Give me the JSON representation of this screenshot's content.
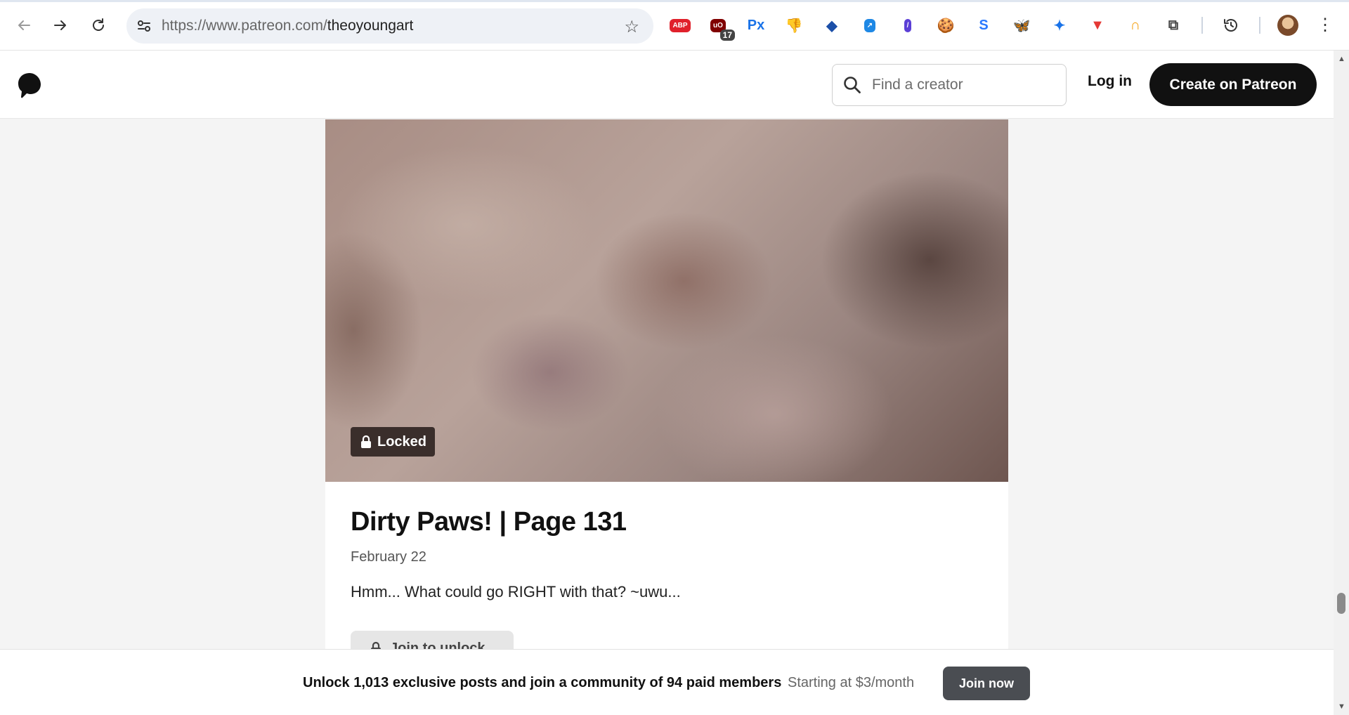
{
  "browser": {
    "url_prefix": "https://www.patreon.com/",
    "url_path": "theoyoungart",
    "extensions": [
      {
        "name": "abp-icon",
        "label": "ABP",
        "color": "#e0202b",
        "text_color": "#ffffff"
      },
      {
        "name": "ublock-icon",
        "label": "uO",
        "color": "#800000",
        "text_color": "#ffffff",
        "badge": "17"
      },
      {
        "name": "pixiv-px-icon",
        "label": "Px",
        "color": "#ffffff",
        "text_color": "#1a73e8"
      },
      {
        "name": "thumbs-down-icon",
        "label": "👎",
        "color": "#ffffff",
        "text_color": "#e00000"
      },
      {
        "name": "bitwarden-icon",
        "label": "◆",
        "color": "#ffffff",
        "text_color": "#1b4fa8"
      },
      {
        "name": "arrow-extension-icon",
        "label": "↗",
        "color": "#1e88e5",
        "text_color": "#ffffff"
      },
      {
        "name": "pen-extension-icon",
        "label": "/",
        "color": "#5b3fd6",
        "text_color": "#ffffff"
      },
      {
        "name": "cookie-icon",
        "label": "🍪",
        "color": "#ffffff",
        "text_color": "#b5651d"
      },
      {
        "name": "sync-extension-icon",
        "label": "S",
        "color": "#ffffff",
        "text_color": "#2979ff"
      },
      {
        "name": "bluesky-icon",
        "label": "🦋",
        "color": "#ffffff",
        "text_color": "#1185fe"
      },
      {
        "name": "butterfly-extension-icon",
        "label": "✦",
        "color": "#ffffff",
        "text_color": "#1a73e8"
      },
      {
        "name": "shield-extension-icon",
        "label": "▼",
        "color": "#ffffff",
        "text_color": "#e53935"
      },
      {
        "name": "orange-extension-icon",
        "label": "∩",
        "color": "#ffffff",
        "text_color": "#f59e0b"
      },
      {
        "name": "puzzle-icon",
        "label": "⧉",
        "color": "#ffffff",
        "text_color": "#444444"
      }
    ]
  },
  "header": {
    "search_placeholder": "Find a creator",
    "login_label": "Log in",
    "create_label": "Create on Patreon"
  },
  "post": {
    "locked_label": "Locked",
    "title": "Dirty Paws! | Page 131",
    "date": "February 22",
    "text": "Hmm... What could go RIGHT with that? ~uwu...",
    "unlock_label": "Join to unlock"
  },
  "banner": {
    "main_text": "Unlock 1,013 exclusive posts and join a community of 94 paid members",
    "sub_text": "Starting at $3/month",
    "join_label": "Join now"
  },
  "colors": {
    "brand_dark": "#111111",
    "join_button": "#4a4d52"
  }
}
